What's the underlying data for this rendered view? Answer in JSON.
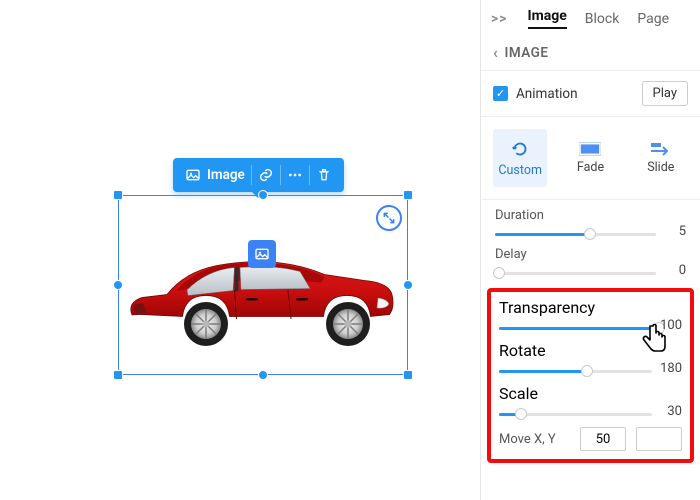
{
  "toolbar": {
    "label": "Image"
  },
  "panel": {
    "tabs": {
      "image": "Image",
      "block": "Block",
      "page": "Page"
    },
    "breadcrumb": "IMAGE",
    "animation": {
      "label": "Animation",
      "play": "Play"
    },
    "presets": {
      "custom": "Custom",
      "fade": "Fade",
      "slide": "Slide"
    },
    "sliders": {
      "duration": {
        "label": "Duration",
        "value": "5"
      },
      "delay": {
        "label": "Delay",
        "value": "0"
      },
      "transparency": {
        "label": "Transparency",
        "value": "100"
      },
      "rotate": {
        "label": "Rotate",
        "value": "180"
      },
      "scale": {
        "label": "Scale",
        "value": "30"
      }
    },
    "move": {
      "label": "Move X, Y",
      "x": "50"
    }
  }
}
